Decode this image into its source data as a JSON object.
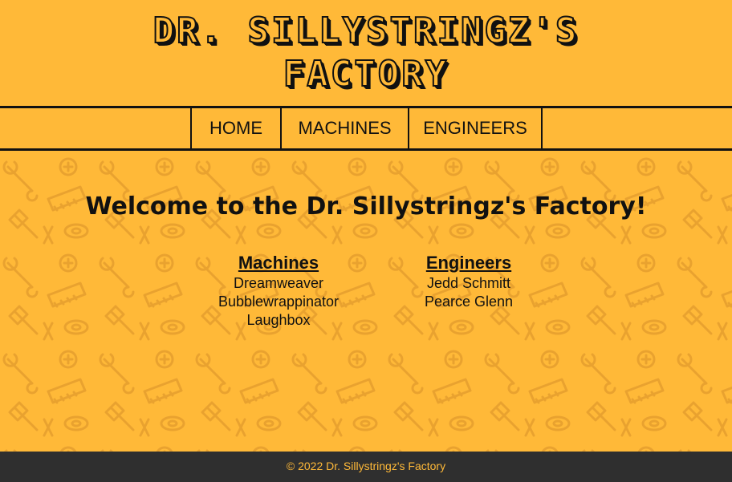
{
  "header": {
    "title_line1": "DR. SILLYSTRINGZ'S",
    "title_line2": "FACTORY"
  },
  "nav": {
    "items": [
      {
        "label": "HOME"
      },
      {
        "label": "MACHINES"
      },
      {
        "label": "ENGINEERS"
      }
    ]
  },
  "main": {
    "welcome": "Welcome to the Dr. Sillystringz's Factory!",
    "machines": {
      "heading": "Machines",
      "items": [
        "Dreamweaver",
        "Bubblewrappinator",
        "Laughbox"
      ]
    },
    "engineers": {
      "heading": "Engineers",
      "items": [
        "Jedd Schmitt",
        "Pearce Glenn"
      ]
    }
  },
  "footer": {
    "text": "© 2022 Dr. Sillystringz's Factory"
  },
  "colors": {
    "background": "#FFB938",
    "pattern": "#E9A22F",
    "text": "#111111",
    "footer_bg": "#2F2F2F",
    "footer_text": "#FFB938"
  }
}
